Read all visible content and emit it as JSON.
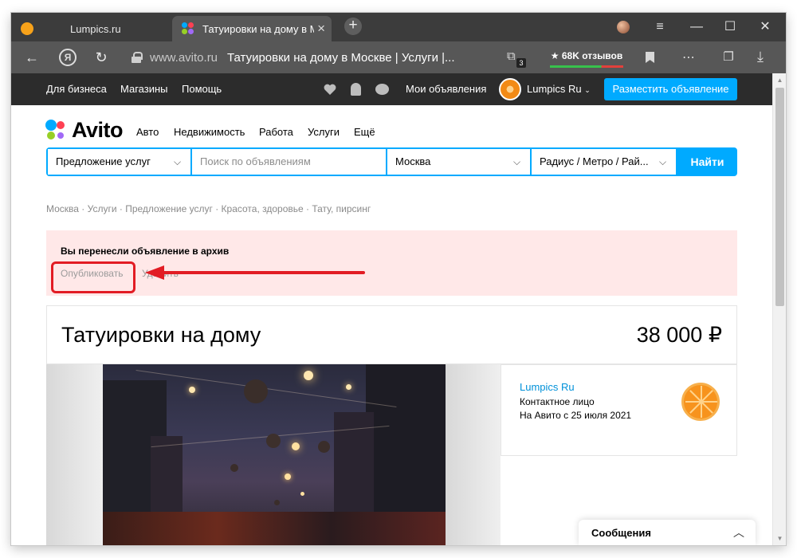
{
  "browser": {
    "tabs": [
      {
        "title": "Lumpics.ru"
      },
      {
        "title": "Татуировки на дому в М",
        "close": "×"
      }
    ],
    "new_tab": "+",
    "window_controls": {
      "menu": "≡",
      "minimize": "—",
      "maximize": "☐",
      "close": "✕"
    },
    "address": {
      "host": "www.avito.ru",
      "page_title": "Татуировки на дому в Москве | Услуги |...",
      "ext_badge_count": "3",
      "reviews": "★ 68K отзывов"
    }
  },
  "site_bar": {
    "links": [
      "Для бизнеса",
      "Магазины",
      "Помощь"
    ],
    "my_ads": "Мои объявления",
    "user": "Lumpics Ru",
    "post_button": "Разместить объявление"
  },
  "logo_text": "Avito",
  "main_nav": [
    "Авто",
    "Недвижимость",
    "Работа",
    "Услуги",
    "Ещё"
  ],
  "search": {
    "category": "Предложение услуг",
    "placeholder": "Поиск по объявлениям",
    "city": "Москва",
    "radius": "Радиус / Метро / Рай...",
    "find_button": "Найти"
  },
  "breadcrumbs": "Москва · Услуги · Предложение услуг · Красота, здоровье · Тату, пирсинг",
  "notice": {
    "text": "Вы перенесли объявление в архив",
    "publish": "Опубликовать",
    "delete": "Удалить"
  },
  "listing": {
    "title": "Татуировки на дому",
    "price": "38 000 ₽"
  },
  "seller": {
    "name": "Lumpics Ru",
    "role": "Контактное лицо",
    "since": "На Авито с 25 июля 2021"
  },
  "messages_widget": {
    "label": "Сообщения"
  },
  "colors": {
    "accent": "#00aaff",
    "notice_bg": "#ffe8e8",
    "annotation_red": "#e21c24"
  }
}
